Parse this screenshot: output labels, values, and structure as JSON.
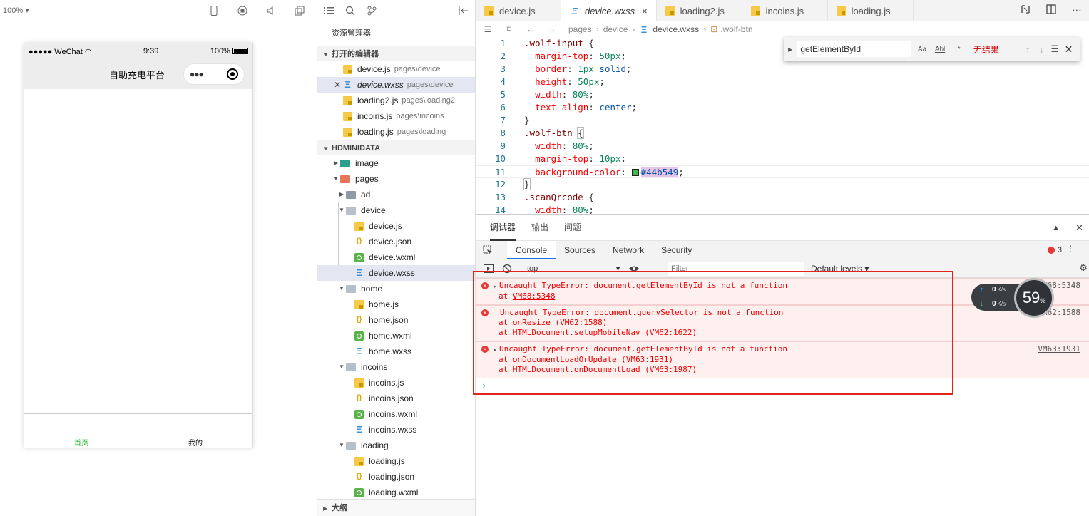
{
  "simulator": {
    "zoom": "100%",
    "status": {
      "carrier": "●●●●● WeChat",
      "time": "9:39",
      "battery": "100%"
    },
    "nav_title": "自助充电平台",
    "tabbar": [
      {
        "label": "首页",
        "color": "#1aad19"
      },
      {
        "label": "我的",
        "color": "#000000"
      }
    ]
  },
  "explorer": {
    "title": "资源管理器",
    "open_editors_header": "打开的编辑器",
    "open_editors": [
      {
        "name": "device.js",
        "path": "pages\\device",
        "type": "js"
      },
      {
        "name": "device.wxss",
        "path": "pages\\device",
        "type": "wxss"
      },
      {
        "name": "loading2.js",
        "path": "pages\\loading2",
        "type": "js"
      },
      {
        "name": "incoins.js",
        "path": "pages\\incoins",
        "type": "js"
      },
      {
        "name": "loading.js",
        "path": "pages\\loading",
        "type": "js"
      }
    ],
    "project_header": "HDMINIDATA",
    "tree": [
      {
        "name": "image",
        "type": "folder-image",
        "expanded": false
      },
      {
        "name": "pages",
        "type": "folder-pages",
        "expanded": true
      },
      {
        "name": "ad",
        "type": "folder",
        "expanded": false
      },
      {
        "name": "device",
        "type": "folder-open",
        "expanded": true
      },
      {
        "name": "device.js",
        "type": "js"
      },
      {
        "name": "device.json",
        "type": "json"
      },
      {
        "name": "device.wxml",
        "type": "wxml"
      },
      {
        "name": "device.wxss",
        "type": "wxss"
      },
      {
        "name": "home",
        "type": "folder-open",
        "expanded": true
      },
      {
        "name": "home.js",
        "type": "js"
      },
      {
        "name": "home.json",
        "type": "json"
      },
      {
        "name": "home.wxml",
        "type": "wxml"
      },
      {
        "name": "home.wxss",
        "type": "wxss"
      },
      {
        "name": "incoins",
        "type": "folder-open",
        "expanded": true
      },
      {
        "name": "incoins.js",
        "type": "js"
      },
      {
        "name": "incoins.json",
        "type": "json"
      },
      {
        "name": "incoins.wxml",
        "type": "wxml"
      },
      {
        "name": "incoins.wxss",
        "type": "wxss"
      },
      {
        "name": "loading",
        "type": "folder-open",
        "expanded": true
      },
      {
        "name": "loading.js",
        "type": "js"
      },
      {
        "name": "loading.json",
        "type": "json"
      },
      {
        "name": "loading.wxml",
        "type": "wxml"
      }
    ],
    "outline_header": "大纲"
  },
  "editor": {
    "tabs": [
      {
        "name": "device.js",
        "type": "js"
      },
      {
        "name": "device.wxss",
        "type": "wxss",
        "close": "×"
      },
      {
        "name": "loading2.js",
        "type": "js"
      },
      {
        "name": "incoins.js",
        "type": "js"
      },
      {
        "name": "loading.js",
        "type": "js"
      }
    ],
    "breadcrumb": [
      "pages",
      "device",
      "device.wxss",
      ".wolf-btn"
    ],
    "lines": [
      {
        "n": "1",
        "text": ".wolf-input {"
      },
      {
        "n": "2",
        "text": "  margin-top: 50px;"
      },
      {
        "n": "3",
        "text": "  border: 1px solid;"
      },
      {
        "n": "4",
        "text": "  height: 50px;"
      },
      {
        "n": "5",
        "text": "  width: 80%;"
      },
      {
        "n": "6",
        "text": "  text-align: center;"
      },
      {
        "n": "7",
        "text": "}"
      },
      {
        "n": "8",
        "text": ".wolf-btn {"
      },
      {
        "n": "9",
        "text": "  width: 80%;"
      },
      {
        "n": "10",
        "text": "  margin-top: 10px;"
      },
      {
        "n": "11",
        "text": "  background-color: #44b549;"
      },
      {
        "n": "12",
        "text": "}"
      },
      {
        "n": "13",
        "text": ".scanQrcode {"
      },
      {
        "n": "14",
        "text": "  width: 80%;"
      }
    ],
    "swatch_color": "#44b549",
    "find": {
      "value": "getElementById",
      "match_case": "Aa",
      "whole_word": "Abl",
      "regex": ".*",
      "result": "无结果"
    }
  },
  "debugger": {
    "tabs": [
      "调试器",
      "输出",
      "问题"
    ],
    "devtools_tabs": [
      "Console",
      "Sources",
      "Network",
      "Security"
    ],
    "error_count": "3",
    "context": "top",
    "filter_placeholder": "Filter",
    "levels": "Default levels ▾",
    "messages": [
      {
        "text": "Uncaught TypeError: document.getElementById is not a function",
        "frames": [
          {
            "prefix": "at ",
            "loc": "VM68:5348",
            "suffix": ""
          }
        ],
        "source": "VM68:5348"
      },
      {
        "text": "Uncaught TypeError: document.querySelector is not a function",
        "frames": [
          {
            "prefix": "at onResize (",
            "loc": "VM62:1588",
            "suffix": ")"
          },
          {
            "prefix": "at HTMLDocument.setupMobileNav (",
            "loc": "VM62:1622",
            "suffix": ")"
          }
        ],
        "source": "VM62:1588"
      },
      {
        "text": "Uncaught TypeError: document.getElementById is not a function",
        "frames": [
          {
            "prefix": "at onDocumentLoadOrUpdate (",
            "loc": "VM63:1931",
            "suffix": ")"
          },
          {
            "prefix": "at HTMLDocument.onDocumentLoad (",
            "loc": "VM63:1987",
            "suffix": ")"
          }
        ],
        "source": "VM63:1931"
      }
    ],
    "prompt": "›"
  },
  "speed": {
    "up": "0",
    "down": "0",
    "unit": "K/s",
    "cpu": "59",
    "cpu_unit": "%"
  },
  "colors": {
    "accent": "#1a73e8",
    "error": "#e53935",
    "highlight": "#e2231a",
    "wechat_green": "#1aad19"
  }
}
